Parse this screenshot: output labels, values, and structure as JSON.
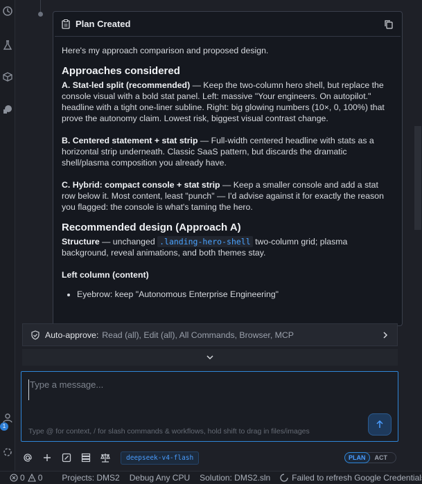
{
  "plan_card": {
    "title": "Plan Created",
    "intro": "Here's my approach comparison and proposed design.",
    "approaches_heading": "Approaches considered",
    "approach_a_title": "A. Stat-led split (recommended)",
    "approach_a_text": " — Keep the two-column hero shell, but replace the console visual with a bold stat panel. Left: massive \"Your engineers. On autopilot.\" headline with a tight one-liner subline. Right: big glowing numbers (10×, 0, 100%) that prove the autonomy claim. Lowest risk, biggest visual contrast change.",
    "approach_b_title": "B. Centered statement + stat strip",
    "approach_b_text": " — Full-width centered headline with stats as a horizontal strip underneath. Classic SaaS pattern, but discards the dramatic shell/plasma composition you already have.",
    "approach_c_title": "C. Hybrid: compact console + stat strip",
    "approach_c_text": " — Keep a smaller console and add a stat row below it. Most content, least \"punch\" — I'd advise against it for exactly the reason you flagged: the console is what's taming the hero.",
    "recommended_heading": "Recommended design (Approach A)",
    "structure_label": "Structure",
    "structure_pre": " — unchanged ",
    "structure_code": ".landing-hero-shell",
    "structure_post": " two-column grid; plasma background, reveal animations, and both themes stay.",
    "left_column_heading": "Left column (content)",
    "bullets": [
      "Eyebrow: keep \"Autonomous Enterprise Engineering\""
    ]
  },
  "auto_approve": {
    "label": "Auto-approve:",
    "values": "Read (all), Edit (all), All Commands, Browser, MCP"
  },
  "message": {
    "placeholder": "Type a message...",
    "hint": "Type @ for context, / for slash commands & workflows, hold shift to drag in files/images"
  },
  "toolbar": {
    "model": "deepseek-v4-flash",
    "plan_label": "PLAN",
    "act_label": "ACT"
  },
  "activity": {
    "badge_count": "1"
  },
  "status_bar": {
    "errors": "0",
    "warnings": "0",
    "projects": "Projects: DMS2",
    "debug": "Debug Any CPU",
    "solution": "Solution: DMS2.sln",
    "message": "Failed to refresh Google Credentials"
  },
  "colors": {
    "accent": "#2f86d8",
    "link_code": "#4aa3ff",
    "card_bg": "#15181f"
  }
}
